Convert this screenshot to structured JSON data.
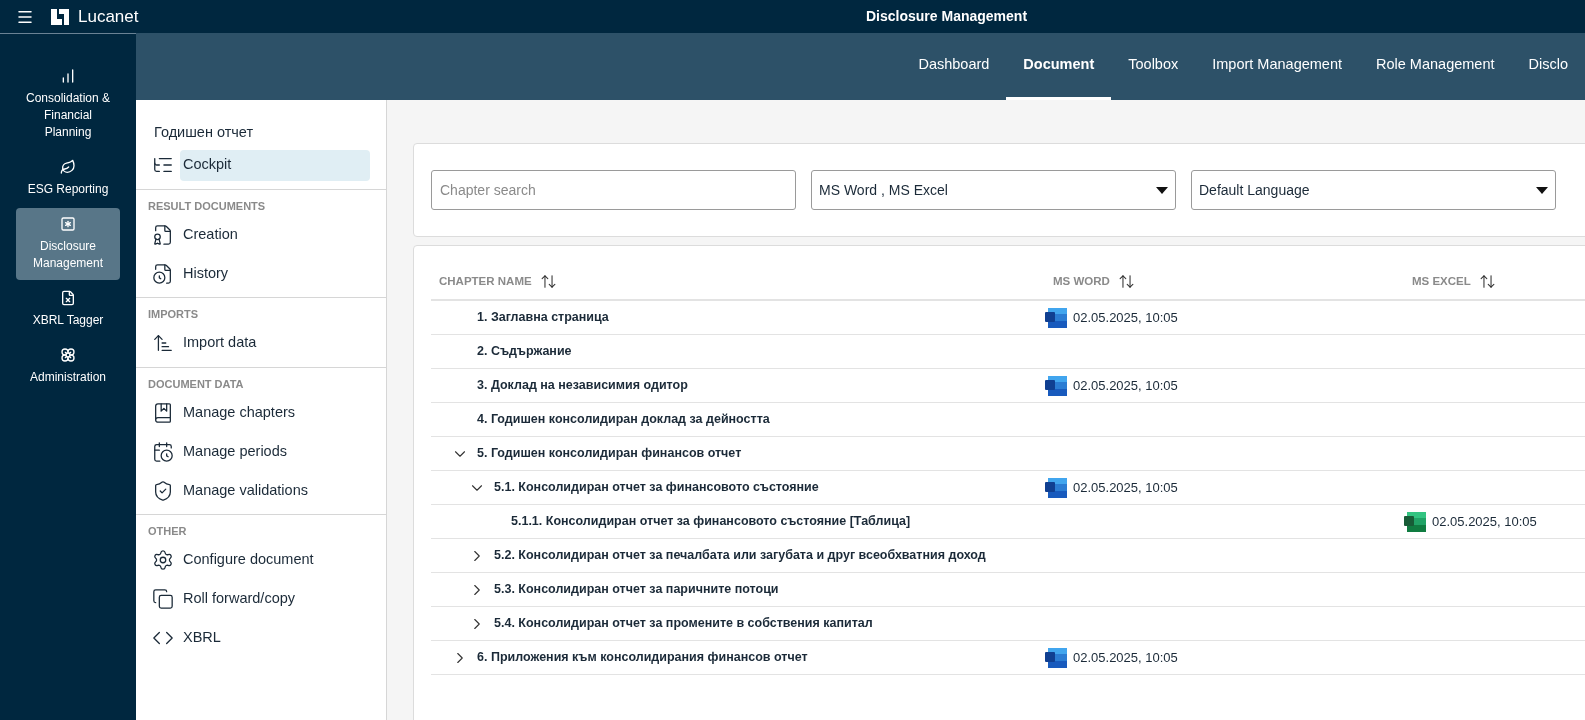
{
  "top_bar": {
    "brand": "Lucanet",
    "title": "Disclosure Management"
  },
  "rail": [
    {
      "label": "Consolidation & Financial Planning",
      "selected": false
    },
    {
      "label": "ESG Reporting",
      "selected": false
    },
    {
      "label": "Disclosure Management",
      "selected": true
    },
    {
      "label": "XBRL Tagger",
      "selected": false
    },
    {
      "label": "Administration",
      "selected": false
    }
  ],
  "tabs": [
    {
      "label": "Dashboard",
      "selected": false
    },
    {
      "label": "Document",
      "selected": true
    },
    {
      "label": "Toolbox",
      "selected": false
    },
    {
      "label": "Import Management",
      "selected": false
    },
    {
      "label": "Role Management",
      "selected": false
    },
    {
      "label": "Disclo",
      "selected": false
    }
  ],
  "side_panel": {
    "title": "Годишен отчет",
    "sections": [
      {
        "items": [
          {
            "label": "Cockpit",
            "selected": true
          }
        ]
      },
      {
        "header": "RESULT DOCUMENTS",
        "items": [
          {
            "label": "Creation",
            "selected": false
          },
          {
            "label": "History",
            "selected": false
          }
        ]
      },
      {
        "header": "IMPORTS",
        "items": [
          {
            "label": "Import data",
            "selected": false
          }
        ]
      },
      {
        "header": "DOCUMENT DATA",
        "items": [
          {
            "label": "Manage chapters",
            "selected": false
          },
          {
            "label": "Manage periods",
            "selected": false
          },
          {
            "label": "Manage validations",
            "selected": false
          }
        ]
      },
      {
        "header": "OTHER",
        "items": [
          {
            "label": "Configure document",
            "selected": false
          },
          {
            "label": "Roll forward/copy",
            "selected": false
          },
          {
            "label": "XBRL",
            "selected": false
          }
        ]
      }
    ]
  },
  "filters": {
    "search": {
      "placeholder": "Chapter search"
    },
    "formats": {
      "value": "MS Word , MS Excel"
    },
    "language": {
      "value": "Default Language"
    }
  },
  "table": {
    "columns": [
      "CHAPTER NAME",
      "MS WORD",
      "MS EXCEL"
    ],
    "rows": [
      {
        "name": "1. Заглавна страница",
        "kind": "leaf",
        "word": "02.05.2025, 10:05"
      },
      {
        "name": "2. Съдържание",
        "kind": "leaf"
      },
      {
        "name": "3. Доклад на независимия одитор",
        "kind": "leaf",
        "word": "02.05.2025, 10:05"
      },
      {
        "name": "4. Годишен консолидиран доклад за дейността",
        "kind": "leaf"
      },
      {
        "name": "5. Годишен консолидиран финансов отчет",
        "kind": "branch",
        "expanded": true,
        "children": [
          {
            "name": "5.1. Консолидиран отчет за финансовото състояние",
            "kind": "branch",
            "expanded": true,
            "word": "02.05.2025, 10:05",
            "children": [
              {
                "name": "5.1.1. Консолидиран отчет за финансовото състояние [Таблица]",
                "kind": "leaf",
                "excel": "02.05.2025, 10:05"
              }
            ]
          },
          {
            "name": "5.2. Консолидиран отчет за печалбата или загубата и друг всеобхватния доход",
            "kind": "branch",
            "expanded": false
          },
          {
            "name": "5.3. Консолидиран отчет за паричните потоци",
            "kind": "branch",
            "expanded": false
          },
          {
            "name": "5.4. Консолидиран отчет за промените в собствения капитал",
            "kind": "branch",
            "expanded": false
          }
        ]
      },
      {
        "name": "6. Приложения към консолидирания финансов отчет",
        "kind": "branch",
        "expanded": false,
        "word": "02.05.2025, 10:05"
      }
    ]
  }
}
